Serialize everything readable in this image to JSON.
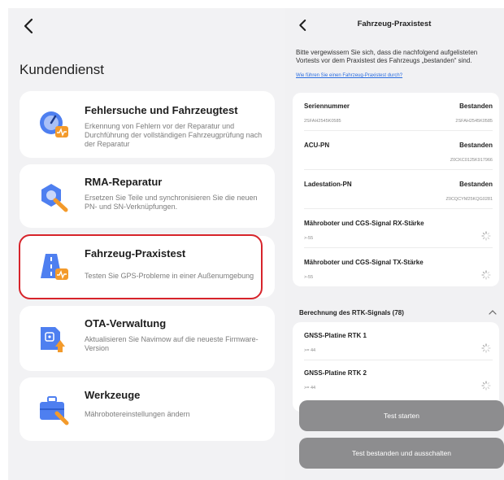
{
  "left": {
    "title": "Kundendienst",
    "cards": [
      {
        "title": "Fehlersuche und Fahrzeugtest",
        "description": "Erkennung von Fehlern vor der Reparatur und Durchführung der vollständigen Fahrzeugprüfung nach der Reparatur",
        "icon": "diagnostic-gauge-icon"
      },
      {
        "title": "RMA-Reparatur",
        "description": "Ersetzen Sie Teile und synchronisieren Sie die neuen PN- und SN-Verknüpfungen.",
        "icon": "repair-wrench-icon"
      },
      {
        "title": "Fahrzeug-Praxistest",
        "description": "Testen Sie GPS-Probleme in einer Außenumgebung",
        "icon": "field-test-road-icon",
        "highlighted": true,
        "highlight_color": "#d7242b"
      },
      {
        "title": "OTA-Verwaltung",
        "description": "Aktualisieren Sie Navimow auf die neueste Firmware-Version",
        "icon": "ota-update-icon"
      },
      {
        "title": "Werkzeuge",
        "description": "Mähroboter­einstellungen ändern",
        "icon": "toolbox-icon"
      }
    ]
  },
  "right": {
    "title": "Fahrzeug-Praxistest",
    "intro": "Bitte vergewissern Sie sich, dass die nachfolgend aufgelisteten Vortests vor dem Praxistest des Fahrzeugs „bestanden“ sind.",
    "link": "Wie führen Sie einen Fahrzeug-Praxistest durch?",
    "pretests": [
      {
        "name": "Seriennummer",
        "status": "Bestanden",
        "left_value": "2SFAH2545K0585",
        "right_value": "2SFAH2545K0585"
      },
      {
        "name": "ACU-PN",
        "status": "Bestanden",
        "left_value": "",
        "right_value": "Z0CKC0125K917966"
      },
      {
        "name": "Ladestation-PN",
        "status": "Bestanden",
        "left_value": "",
        "right_value": "Z0CQCYM25KQG0281"
      },
      {
        "name": "Mähroboter und CGS-Signal RX-Stärke",
        "status": "",
        "left_value": ">-55",
        "right_value": ""
      },
      {
        "name": "Mähroboter und CGS-Signal TX-Stärke",
        "status": "",
        "left_value": ">-55",
        "right_value": ""
      }
    ],
    "rtk_section": "Berechnung des RTK-Signals (78)",
    "rtk_items": [
      {
        "name": "GNSS-Platine RTK 1",
        "left_value": ">= 44"
      },
      {
        "name": "GNSS-Platine RTK 2",
        "left_value": ">= 44"
      }
    ],
    "buttons": {
      "start": "Test starten",
      "pass_off": "Test bestanden und ausschalten"
    },
    "colors": {
      "accent_orange": "#f39a2b",
      "icon_blue": "#4e7ff0",
      "link_blue": "#2a6de0",
      "disabled_button": "#8d8d8f"
    }
  }
}
